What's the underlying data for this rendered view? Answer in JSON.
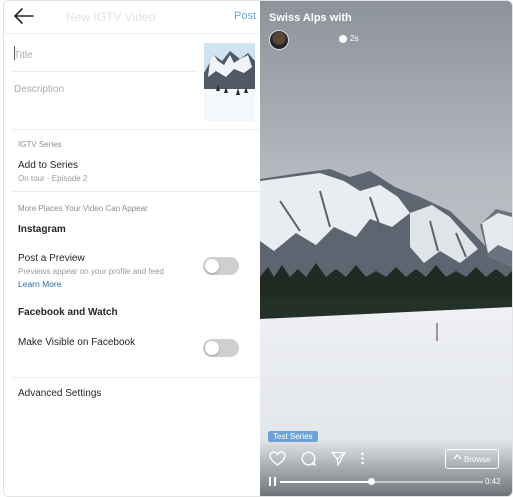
{
  "header": {
    "title": "New IGTV Video",
    "post_label": "Post"
  },
  "form": {
    "title_placeholder": "Title",
    "description_placeholder": "Description"
  },
  "series": {
    "section_label": "IGTV Series",
    "add_label": "Add to Series",
    "add_sub": "On tour · Episode 2"
  },
  "more_places": {
    "section_label": "More Places Your Video Can Appear",
    "instagram_heading": "Instagram",
    "preview_title": "Post a Preview",
    "preview_sub": "Previews appear on your profile and feed",
    "learn_more": "Learn More",
    "preview_enabled": false,
    "facebook_heading": "Facebook and Watch",
    "fb_title": "Make Visible on Facebook",
    "fb_enabled": false
  },
  "advanced_label": "Advanced Settings",
  "video": {
    "title": "Swiss Alps with",
    "time_ago": "2s",
    "series_badge": "Test Series",
    "browse_label": "Browse",
    "duration": "0:42",
    "progress": 0.45
  },
  "icons": {
    "back": "back-arrow-icon",
    "like": "heart-icon",
    "comment": "comment-icon",
    "share": "send-icon",
    "more": "more-vertical-icon",
    "browse": "chevron-up-icon",
    "pause": "pause-icon"
  },
  "colors": {
    "link": "#2d6ea8",
    "post": "#6fa8dc",
    "toggle_off": "#cfcfcf",
    "badge": "#5a96d2"
  }
}
